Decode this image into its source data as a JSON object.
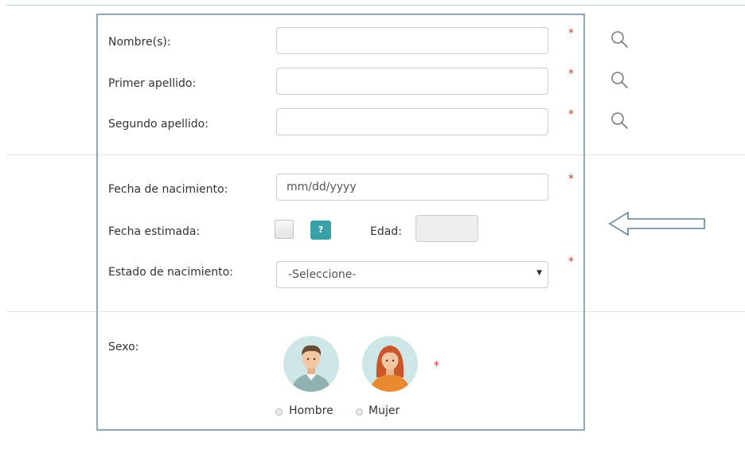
{
  "form": {
    "name": {
      "label": "Nombre(s):",
      "value": ""
    },
    "first_surname": {
      "label": "Primer apellido:",
      "value": ""
    },
    "second_surname": {
      "label": "Segundo apellido:",
      "value": ""
    },
    "birth_date": {
      "label": "Fecha de nacimiento:",
      "placeholder": "mm/dd/yyyy",
      "value": ""
    },
    "estimated_date": {
      "label": "Fecha estimada:",
      "checked": false,
      "help_label": "?"
    },
    "age": {
      "label": "Edad:",
      "value": ""
    },
    "birth_state": {
      "label": "Estado de nacimiento:",
      "selected": "-Seleccione-"
    },
    "sex": {
      "label": "Sexo:",
      "options": [
        {
          "label": "Hombre",
          "icon": "male-avatar-icon"
        },
        {
          "label": "Mujer",
          "icon": "female-avatar-icon"
        }
      ]
    },
    "required_marker": "*"
  },
  "icons": {
    "search": "search-icon",
    "arrow": "left-arrow-icon",
    "caret": "caret-down-icon"
  },
  "colors": {
    "required": "#e4342b",
    "help_button": "#3aa0a7",
    "frame_border": "#8fa9b6",
    "avatar_bg": "#cfe6e6"
  }
}
